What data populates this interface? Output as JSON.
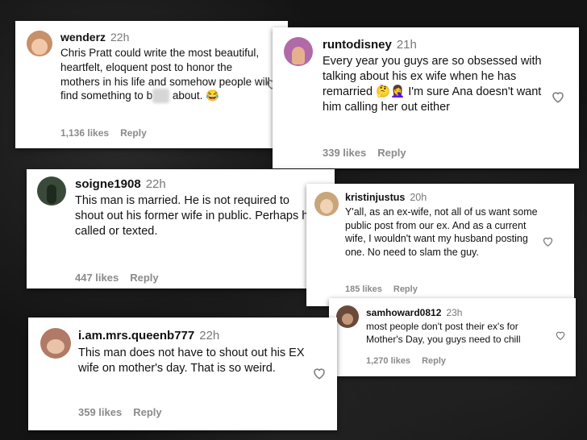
{
  "comments": [
    {
      "username": "wenderz",
      "time": "22h",
      "text_before": "Chris Pratt could write the most beautiful, heartfelt, eloquent post to honor the mothers in his life and somehow people will find something to b",
      "text_blur": "itch",
      "text_after": " about. 😂",
      "likes": "1,136 likes",
      "reply": "Reply",
      "avatar_color": "#c78f6a"
    },
    {
      "username": "runtodisney",
      "time": "21h",
      "text": "Every year you guys are so obsessed with talking about his ex wife when he has remarried 🤔🤦‍♀️ I'm sure Ana doesn't want him calling her out either",
      "likes": "339 likes",
      "reply": "Reply",
      "avatar_color": "#b06aa8"
    },
    {
      "username": "soigne1908",
      "time": "22h",
      "text": "This man is married. He is not required to shout out his former wife in public. Perhaps he called or texted.",
      "likes": "447 likes",
      "reply": "Reply",
      "avatar_color": "#3a4a3a"
    },
    {
      "username": "kristinjustus",
      "time": "20h",
      "text": "Y'all, as an ex-wife, not all of us want some public post from our ex. And as a current wife, I wouldn't want my husband posting one. No need to slam the guy.",
      "likes": "185 likes",
      "reply": "Reply",
      "avatar_color": "#c9a57a"
    },
    {
      "username": "samhoward0812",
      "time": "23h",
      "text": "most people don't post their ex's for Mother's Day, you guys need to chill",
      "likes": "1,270 likes",
      "reply": "Reply",
      "avatar_color": "#6b4a3a"
    },
    {
      "username": "i.am.mrs.queenb777",
      "time": "22h",
      "text": "This man does not have to shout out his EX wife on mother's day. That is so weird.",
      "likes": "359 likes",
      "reply": "Reply",
      "avatar_color": "#b07a66"
    }
  ]
}
